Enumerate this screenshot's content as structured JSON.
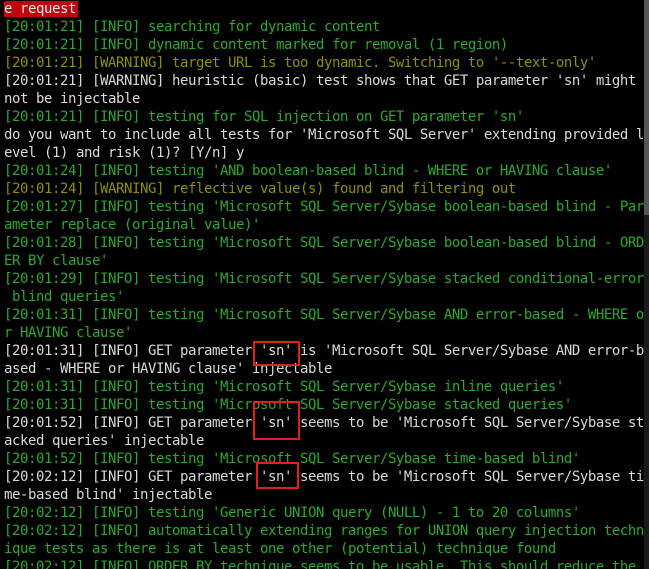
{
  "terminal": {
    "lines": [
      {
        "text": "e request",
        "color": "hl"
      },
      {
        "text": "[20:01:21] [INFO] searching for dynamic content",
        "color": "g"
      },
      {
        "text": "[20:01:21] [INFO] dynamic content marked for removal (1 region)",
        "color": "g"
      },
      {
        "text": "[20:01:21] [WARNING] target URL is too dynamic. Switching to '--text-only'",
        "color": "y"
      },
      {
        "text": "[20:01:21] [WARNING] heuristic (basic) test shows that GET parameter 'sn' might",
        "color": "w"
      },
      {
        "text": "not be injectable",
        "color": "w"
      },
      {
        "text": "[20:01:21] [INFO] testing for SQL injection on GET parameter 'sn'",
        "color": "g"
      },
      {
        "text": "do you want to include all tests for 'Microsoft SQL Server' extending provided l",
        "color": "w"
      },
      {
        "text": "evel (1) and risk (1)? [Y/n] y",
        "color": "w"
      },
      {
        "text": "[20:01:24] [INFO] testing 'AND boolean-based blind - WHERE or HAVING clause'",
        "color": "g"
      },
      {
        "text": "[20:01:24] [WARNING] reflective value(s) found and filtering out",
        "color": "y"
      },
      {
        "text": "[20:01:27] [INFO] testing 'Microsoft SQL Server/Sybase boolean-based blind - Par",
        "color": "g"
      },
      {
        "text": "ameter replace (original value)'",
        "color": "g"
      },
      {
        "text": "[20:01:28] [INFO] testing 'Microsoft SQL Server/Sybase boolean-based blind - ORD",
        "color": "g"
      },
      {
        "text": "ER BY clause'",
        "color": "g"
      },
      {
        "text": "[20:01:29] [INFO] testing 'Microsoft SQL Server/Sybase stacked conditional-error",
        "color": "g"
      },
      {
        "text": " blind queries'",
        "color": "g"
      },
      {
        "text": "[20:01:31] [INFO] testing 'Microsoft SQL Server/Sybase AND error-based - WHERE o",
        "color": "g"
      },
      {
        "text": "r HAVING clause'",
        "color": "g"
      },
      {
        "text": "[20:01:31] [INFO] GET parameter 'sn' is 'Microsoft SQL Server/Sybase AND error-b",
        "color": "w"
      },
      {
        "text": "ased - WHERE or HAVING clause' injectable",
        "color": "w"
      },
      {
        "text": "[20:01:31] [INFO] testing 'Microsoft SQL Server/Sybase inline queries'",
        "color": "g"
      },
      {
        "text": "[20:01:31] [INFO] testing 'Microsoft SQL Server/Sybase stacked queries'",
        "color": "g"
      },
      {
        "text": "[20:01:52] [INFO] GET parameter 'sn' seems to be 'Microsoft SQL Server/Sybase st",
        "color": "w"
      },
      {
        "text": "acked queries' injectable",
        "color": "w"
      },
      {
        "text": "[20:01:52] [INFO] testing 'Microsoft SQL Server/Sybase time-based blind'",
        "color": "g"
      },
      {
        "text": "[20:02:12] [INFO] GET parameter 'sn' seems to be 'Microsoft SQL Server/Sybase ti",
        "color": "w"
      },
      {
        "text": "me-based blind' injectable",
        "color": "w"
      },
      {
        "text": "[20:02:12] [INFO] testing 'Generic UNION query (NULL) - 1 to 20 columns'",
        "color": "g"
      },
      {
        "text": "[20:02:12] [INFO] automatically extending ranges for UNION query injection techn",
        "color": "g"
      },
      {
        "text": "ique tests as there is at least one other (potential) technique found",
        "color": "g"
      },
      {
        "text": "[20:02:12] [INFO] ORDER BY technique seems to be usable. This should reduce the",
        "color": "g"
      }
    ]
  },
  "colors": {
    "background": "#000000",
    "info_green": "#2ea82e",
    "warning_yellow": "#8f8f00",
    "prompt_white": "#d9d9d9",
    "highlight_red": "#c0000a",
    "annotation_red": "#e0201a"
  }
}
